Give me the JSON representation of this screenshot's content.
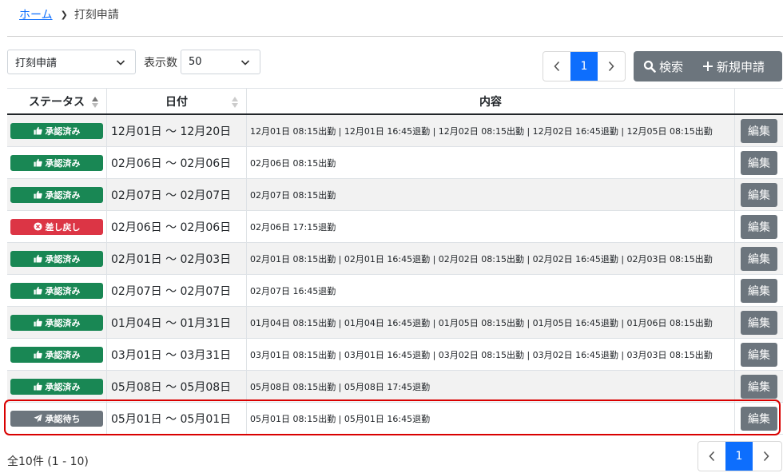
{
  "breadcrumb": {
    "home": "ホーム",
    "current": "打刻申請"
  },
  "filter": {
    "type_value": "打刻申請",
    "count_label": "表示数",
    "count_value": "50"
  },
  "pagination": {
    "current": "1"
  },
  "actions": {
    "search": "検索",
    "new": "新規申請"
  },
  "table": {
    "headers": {
      "status": "ステータス",
      "date": "日付",
      "content": "内容"
    },
    "rows": [
      {
        "status": "承認済み",
        "status_type": "approved",
        "date": "12月01日 〜 12月20日",
        "content": "12月01日 08:15出勤 | 12月01日 16:45退勤 | 12月02日 08:15出勤 | 12月02日 16:45退勤 | 12月05日 08:15出勤",
        "edit": "編集"
      },
      {
        "status": "承認済み",
        "status_type": "approved",
        "date": "02月06日 〜 02月06日",
        "content": "02月06日 08:15出勤",
        "edit": "編集"
      },
      {
        "status": "承認済み",
        "status_type": "approved",
        "date": "02月07日 〜 02月07日",
        "content": "02月07日 08:15出勤",
        "edit": "編集"
      },
      {
        "status": "差し戻し",
        "status_type": "rejected",
        "date": "02月06日 〜 02月06日",
        "content": "02月06日 17:15退勤",
        "edit": "編集"
      },
      {
        "status": "承認済み",
        "status_type": "approved",
        "date": "02月01日 〜 02月03日",
        "content": "02月01日 08:15出勤 | 02月01日 16:45退勤 | 02月02日 08:15出勤 | 02月02日 16:45退勤 | 02月03日 08:15出勤",
        "edit": "編集"
      },
      {
        "status": "承認済み",
        "status_type": "approved",
        "date": "02月07日 〜 02月07日",
        "content": "02月07日 16:45退勤",
        "edit": "編集"
      },
      {
        "status": "承認済み",
        "status_type": "approved",
        "date": "01月04日 〜 01月31日",
        "content": "01月04日 08:15出勤 | 01月04日 16:45退勤 | 01月05日 08:15出勤 | 01月05日 16:45退勤 | 01月06日 08:15出勤",
        "edit": "編集"
      },
      {
        "status": "承認済み",
        "status_type": "approved",
        "date": "03月01日 〜 03月31日",
        "content": "03月01日 08:15出勤 | 03月01日 16:45退勤 | 03月02日 08:15出勤 | 03月02日 16:45退勤 | 03月03日 08:15出勤",
        "edit": "編集"
      },
      {
        "status": "承認済み",
        "status_type": "approved",
        "date": "05月08日 〜 05月08日",
        "content": "05月08日 08:15出勤 | 05月08日 17:45退勤",
        "edit": "編集"
      },
      {
        "status": "承認待ち",
        "status_type": "pending",
        "date": "05月01日 〜 05月01日",
        "content": "05月01日 08:15出勤 | 05月01日 16:45退勤",
        "edit": "編集"
      }
    ]
  },
  "footer": {
    "total": "全10件 (1 - 10)"
  },
  "colors": {
    "primary": "#0d6efd",
    "approved": "#198754",
    "rejected": "#dc3545",
    "pending": "#6c757d",
    "highlight": "#d90000"
  }
}
